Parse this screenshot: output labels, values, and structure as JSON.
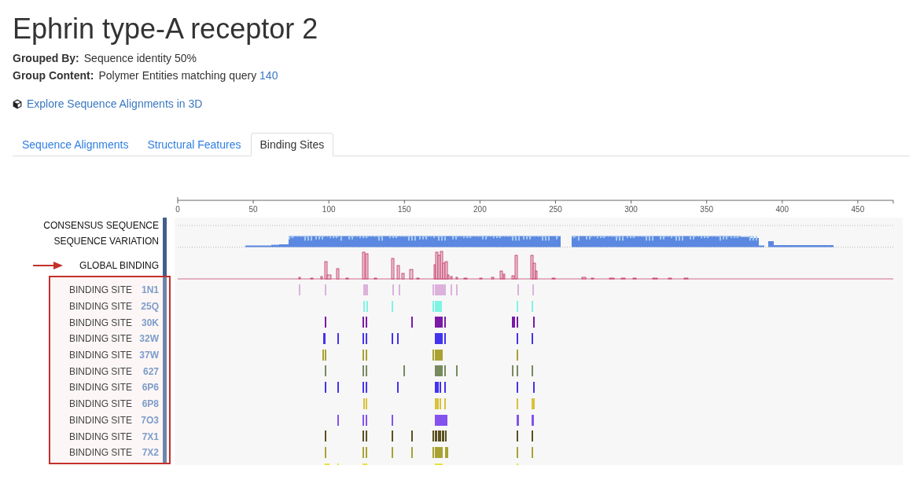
{
  "title": "Ephrin type-A receptor 2",
  "details": [
    {
      "label": "Grouped By:",
      "value": "Sequence identity 50%"
    },
    {
      "label": "Group Content:",
      "value": "Polymer Entities matching query",
      "link": "140"
    }
  ],
  "explore_link": {
    "label": "Explore Sequence Alignments in 3D"
  },
  "tabs": [
    {
      "label": "Sequence Alignments",
      "selected": false
    },
    {
      "label": "Structural Features",
      "selected": false
    },
    {
      "label": "Binding Sites",
      "selected": true
    }
  ],
  "viewer": {
    "axis_ticks": [
      "0",
      "50",
      "100",
      "150",
      "200",
      "250",
      "300",
      "350",
      "400",
      "450"
    ],
    "rows": [
      {
        "kind": "consensus",
        "label": "CONSENSUS SEQUENCE"
      },
      {
        "kind": "variation",
        "label": "SEQUENCE VARIATION"
      },
      {
        "kind": "global_binding",
        "label": "GLOBAL BINDING"
      },
      {
        "kind": "binding_site",
        "label": "BINDING SITE",
        "entry": "1N1",
        "color": "#dcb2dc"
      },
      {
        "kind": "binding_site",
        "label": "BINDING SITE",
        "entry": "25Q",
        "color": "#7ef5e3"
      },
      {
        "kind": "binding_site",
        "label": "BINDING SITE",
        "entry": "30K",
        "color": "#7a1aa6"
      },
      {
        "kind": "binding_site",
        "label": "BINDING SITE",
        "entry": "32W",
        "color": "#4433ee"
      },
      {
        "kind": "binding_site",
        "label": "BINDING SITE",
        "entry": "37W",
        "color": "#a9a233"
      },
      {
        "kind": "binding_site",
        "label": "BINDING SITE",
        "entry": "627",
        "color": "#778a5e"
      },
      {
        "kind": "binding_site",
        "label": "BINDING SITE",
        "entry": "6P6",
        "color": "#4433ee"
      },
      {
        "kind": "binding_site",
        "label": "BINDING SITE",
        "entry": "6P8",
        "color": "#d8c23c"
      },
      {
        "kind": "binding_site",
        "label": "BINDING SITE",
        "entry": "7O3",
        "color": "#8452ee"
      },
      {
        "kind": "binding_site",
        "label": "BINDING SITE",
        "entry": "7X1",
        "color": "#5b5120"
      },
      {
        "kind": "binding_site",
        "label": "BINDING SITE",
        "entry": "7X2",
        "color": "#a9a233"
      },
      {
        "kind": "binding_site",
        "color": "#e8e03c"
      }
    ]
  }
}
